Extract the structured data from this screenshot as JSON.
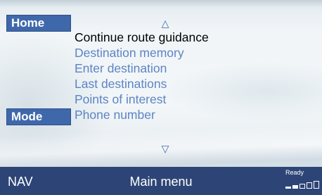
{
  "sidebar": {
    "home_label": "Home",
    "mode_label": "Mode"
  },
  "menu": {
    "scroll_up_glyph": "△",
    "scroll_down_glyph": "▽",
    "items": [
      {
        "label": "Continue route guidance",
        "selected": true
      },
      {
        "label": "Destination memory",
        "selected": false
      },
      {
        "label": "Enter destination",
        "selected": false
      },
      {
        "label": "Last destinations",
        "selected": false
      },
      {
        "label": "Points of interest",
        "selected": false
      },
      {
        "label": "Phone number",
        "selected": false
      }
    ]
  },
  "status_bar": {
    "left_label": "NAV",
    "title": "Main menu",
    "ready_label": "Ready",
    "signal_icon": "signal-strength-icon",
    "signal_level": 0.4
  },
  "colors": {
    "button_blue": "#3f68ab",
    "menu_text": "#5d84c4",
    "selected_text": "#000000",
    "status_bar": "#2d4576"
  }
}
